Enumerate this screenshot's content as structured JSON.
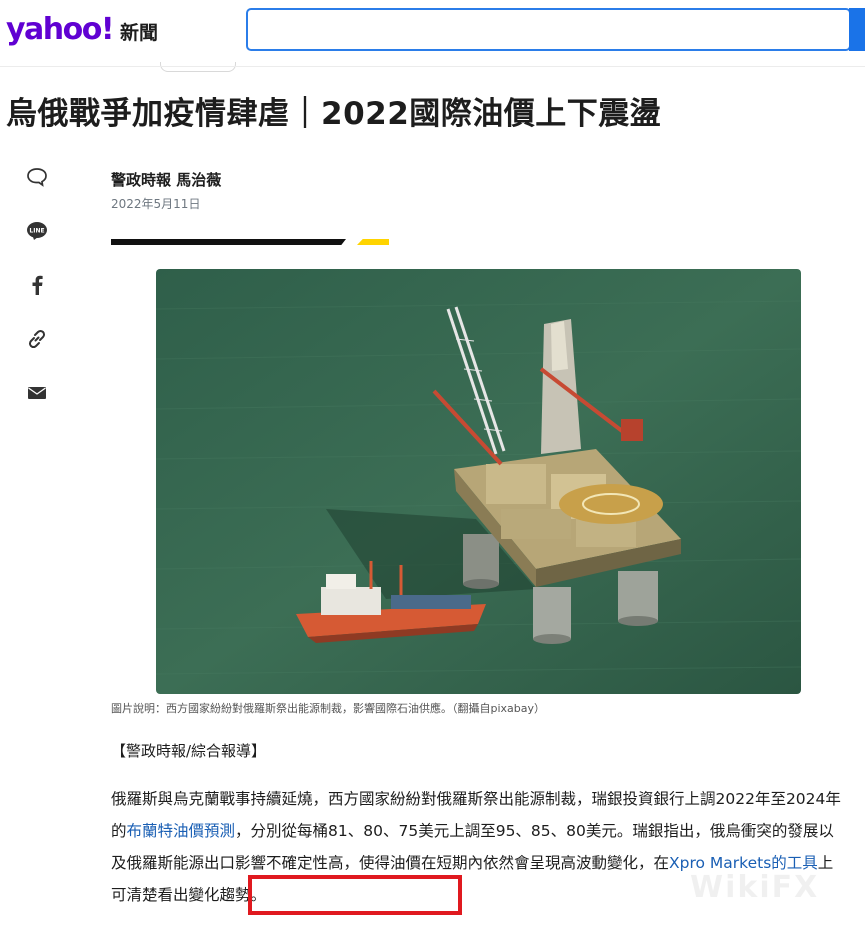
{
  "header": {
    "logo_text": "yahoo!",
    "section_label": "新聞",
    "search_placeholder": "",
    "brand_color": "#6001d2"
  },
  "article": {
    "headline": "烏俄戰爭加疫情肆虐｜2022國際油價上下震盪",
    "byline": "警政時報 馬治薇",
    "date": "2022年5月11日",
    "caption": "圖片說明：西方國家紛紛對俄羅斯祭出能源制裁，影響國際石油供應。（翻攝自pixabay）",
    "source_tag": "【警政時報/綜合報導】",
    "para1_a": "俄羅斯與烏克蘭戰事持續延燒，西方國家紛紛對俄羅斯祭出能源制裁，瑞銀投資銀行上調2022年至2024年的",
    "para1_link": "布蘭特油價預測",
    "para1_b": "，分別從每桶81、80、75美元上調至95、85、80美元。瑞銀指出，俄烏衝突的發展以及俄羅斯能源出口影響不確定性高，使得油價在短期內依然會呈現高波動變化，",
    "para1_c": "在",
    "para1_link2": "Xpro Markets的工具",
    "para1_d": "上可清楚看出變化趨勢。"
  },
  "share_icons": [
    "comment-icon",
    "line-icon",
    "facebook-icon",
    "link-icon",
    "mail-icon"
  ],
  "accent": {
    "highlight_box": "#e0191f",
    "link": "#1a5fb4",
    "accent_yellow": "#ffd400"
  }
}
